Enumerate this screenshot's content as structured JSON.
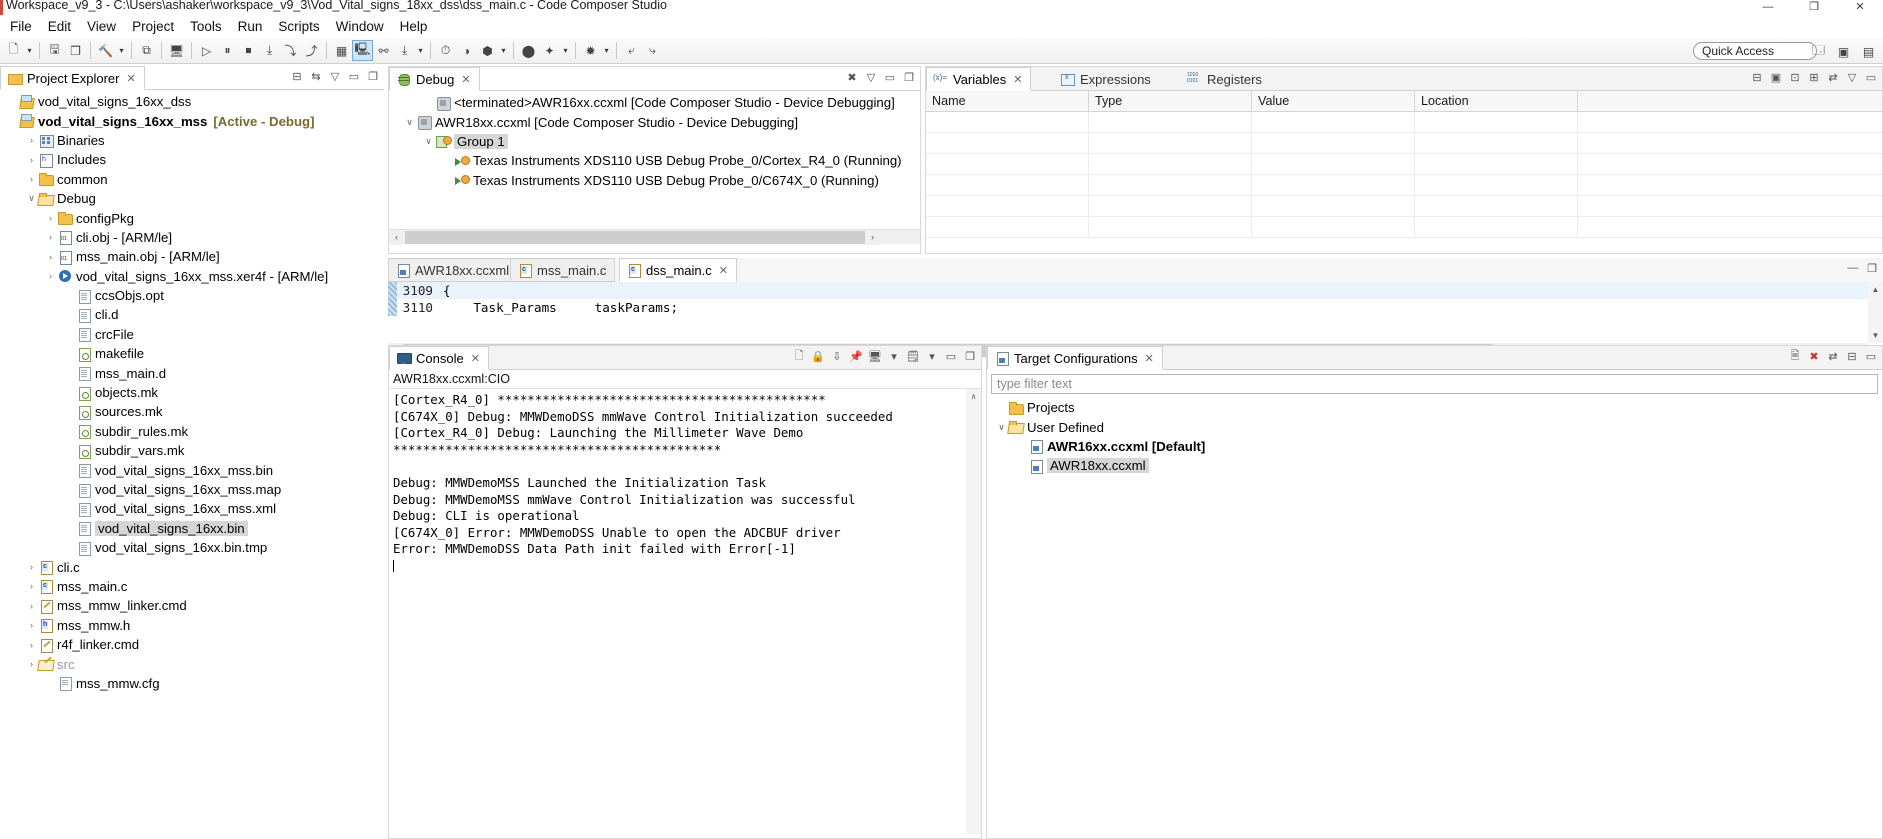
{
  "window": {
    "title": "Workspace_v9_3 - C:\\Users\\ashaker\\workspace_v9_3\\Vod_Vital_signs_18xx_dss\\dss_main.c - Code Composer Studio",
    "minimize": "—",
    "maximize": "❐",
    "close": "✕"
  },
  "menubar": {
    "items": [
      "File",
      "Edit",
      "View",
      "Project",
      "Tools",
      "Run",
      "Scripts",
      "Window",
      "Help"
    ]
  },
  "toolbar": {
    "quick_access_label": "Quick Access",
    "icons": [
      "new-file-icon",
      "save-icon",
      "save-all-icon",
      "build-hammer-icon",
      "debug-skip-icon",
      "terminal-icon",
      "resume-icon",
      "suspend-icon",
      "terminate-icon",
      "step-into-icon",
      "step-over-icon",
      "step-return-icon",
      "grid-icon",
      "restart-icon",
      "connect-target-icon",
      "load-program-icon",
      "clock-icon",
      "disassembly-icon",
      "memory-icon",
      "run-free-icon",
      "profile-icon",
      "debug-perspective-icon",
      "search-icon",
      "link-icon"
    ]
  },
  "project_explorer": {
    "tab_label": "Project Explorer",
    "tools": [
      "collapse-all-icon",
      "link-with-editor-icon"
    ],
    "items": [
      {
        "label": "vod_vital_signs_16xx_dss",
        "icon": "rtsc-project-icon",
        "indent": 0,
        "twist": "",
        "bold": false,
        "suffix": ""
      },
      {
        "label": "vod_vital_signs_16xx_mss",
        "icon": "rtsc-project-icon",
        "indent": 0,
        "twist": "",
        "bold": true,
        "suffix": "[Active - Debug]"
      },
      {
        "label": "Binaries",
        "icon": "binaries-icon",
        "indent": 1,
        "twist": "›",
        "bold": false,
        "suffix": ""
      },
      {
        "label": "Includes",
        "icon": "includes-icon",
        "indent": 1,
        "twist": "›",
        "bold": false,
        "suffix": ""
      },
      {
        "label": "common",
        "icon": "folder-icon",
        "indent": 1,
        "twist": "›",
        "bold": false,
        "suffix": ""
      },
      {
        "label": "Debug",
        "icon": "folder-open-icon",
        "indent": 1,
        "twist": "∨",
        "bold": false,
        "suffix": ""
      },
      {
        "label": "configPkg",
        "icon": "folder-icon",
        "indent": 2,
        "twist": "›",
        "bold": false,
        "suffix": ""
      },
      {
        "label": "cli.obj - [ARM/le]",
        "icon": "object-file-icon",
        "indent": 2,
        "twist": "›",
        "bold": false,
        "suffix": ""
      },
      {
        "label": "mss_main.obj - [ARM/le]",
        "icon": "object-file-icon",
        "indent": 2,
        "twist": "›",
        "bold": false,
        "suffix": ""
      },
      {
        "label": "vod_vital_signs_16xx_mss.xer4f - [ARM/le]",
        "icon": "executable-icon",
        "indent": 2,
        "twist": "›",
        "bold": false,
        "suffix": ""
      },
      {
        "label": "ccsObjs.opt",
        "icon": "file-icon",
        "indent": 3,
        "twist": "",
        "bold": false,
        "suffix": ""
      },
      {
        "label": "cli.d",
        "icon": "file-icon",
        "indent": 3,
        "twist": "",
        "bold": false,
        "suffix": ""
      },
      {
        "label": "crcFile",
        "icon": "file-icon",
        "indent": 3,
        "twist": "",
        "bold": false,
        "suffix": ""
      },
      {
        "label": "makefile",
        "icon": "makefile-icon",
        "indent": 3,
        "twist": "",
        "bold": false,
        "suffix": ""
      },
      {
        "label": "mss_main.d",
        "icon": "file-icon",
        "indent": 3,
        "twist": "",
        "bold": false,
        "suffix": ""
      },
      {
        "label": "objects.mk",
        "icon": "makefile-icon",
        "indent": 3,
        "twist": "",
        "bold": false,
        "suffix": ""
      },
      {
        "label": "sources.mk",
        "icon": "makefile-icon",
        "indent": 3,
        "twist": "",
        "bold": false,
        "suffix": ""
      },
      {
        "label": "subdir_rules.mk",
        "icon": "makefile-icon",
        "indent": 3,
        "twist": "",
        "bold": false,
        "suffix": ""
      },
      {
        "label": "subdir_vars.mk",
        "icon": "makefile-icon",
        "indent": 3,
        "twist": "",
        "bold": false,
        "suffix": ""
      },
      {
        "label": "vod_vital_signs_16xx_mss.bin",
        "icon": "file-icon",
        "indent": 3,
        "twist": "",
        "bold": false,
        "suffix": ""
      },
      {
        "label": "vod_vital_signs_16xx_mss.map",
        "icon": "file-icon",
        "indent": 3,
        "twist": "",
        "bold": false,
        "suffix": ""
      },
      {
        "label": "vod_vital_signs_16xx_mss.xml",
        "icon": "file-icon",
        "indent": 3,
        "twist": "",
        "bold": false,
        "suffix": ""
      },
      {
        "label": "vod_vital_signs_16xx.bin",
        "icon": "file-icon",
        "indent": 3,
        "twist": "",
        "bold": false,
        "suffix": "",
        "selected": true
      },
      {
        "label": "vod_vital_signs_16xx.bin.tmp",
        "icon": "file-icon",
        "indent": 3,
        "twist": "",
        "bold": false,
        "suffix": ""
      },
      {
        "label": "cli.c",
        "icon": "c-file-icon",
        "indent": 1,
        "twist": "›",
        "bold": false,
        "suffix": ""
      },
      {
        "label": "mss_main.c",
        "icon": "c-file-icon",
        "indent": 1,
        "twist": "›",
        "bold": false,
        "suffix": ""
      },
      {
        "label": "mss_mmw_linker.cmd",
        "icon": "cmd-file-icon",
        "indent": 1,
        "twist": "›",
        "bold": false,
        "suffix": ""
      },
      {
        "label": "mss_mmw.h",
        "icon": "h-file-icon",
        "indent": 1,
        "twist": "›",
        "bold": false,
        "suffix": ""
      },
      {
        "label": "r4f_linker.cmd",
        "icon": "cmd-file-icon",
        "indent": 1,
        "twist": "›",
        "bold": false,
        "suffix": ""
      },
      {
        "label": "src",
        "icon": "src-folder-icon",
        "indent": 1,
        "twist": "›",
        "bold": false,
        "suffix": "",
        "grey": true
      },
      {
        "label": "mss_mmw.cfg",
        "icon": "cfg-file-icon",
        "indent": 2,
        "twist": "",
        "bold": false,
        "suffix": ""
      }
    ]
  },
  "debug_view": {
    "tab_label": "Debug",
    "tools": [
      "pin-icon",
      "view-menu-icon",
      "minimize-icon",
      "maximize-icon"
    ],
    "items": [
      {
        "label": "<terminated>AWR16xx.ccxml [Code Composer Studio - Device Debugging]",
        "icon": "debug-node-icon",
        "indent": 1,
        "twist": ""
      },
      {
        "label": "AWR18xx.ccxml [Code Composer Studio - Device Debugging]",
        "icon": "debug-node-icon",
        "indent": 0,
        "twist": "∨"
      },
      {
        "label": "Group 1",
        "icon": "group-icon",
        "indent": 1,
        "twist": "∨",
        "selected": true
      },
      {
        "label": "Texas Instruments XDS110 USB Debug Probe_0/Cortex_R4_0 (Running)",
        "icon": "thread-icon",
        "indent": 2,
        "twist": ""
      },
      {
        "label": "Texas Instruments XDS110 USB Debug Probe_0/C674X_0 (Running)",
        "icon": "thread-icon",
        "indent": 2,
        "twist": ""
      }
    ],
    "scroll_left": "‹",
    "scroll_right": "›"
  },
  "variables_view": {
    "tabs": [
      {
        "label": "Variables",
        "icon": "variables-icon",
        "active": true,
        "closable": true
      },
      {
        "label": "Expressions",
        "icon": "expressions-icon",
        "active": false,
        "closable": false
      },
      {
        "label": "Registers",
        "icon": "registers-icon",
        "active": false,
        "closable": false
      }
    ],
    "columns": [
      "Name",
      "Type",
      "Value",
      "Location"
    ],
    "rows": [],
    "empty_row_count": 6
  },
  "editor": {
    "tabs": [
      {
        "label": "AWR18xx.ccxml",
        "icon": "ccxml-file-icon",
        "active": false,
        "closable": false
      },
      {
        "label": "mss_main.c",
        "icon": "c-file-icon",
        "active": false,
        "closable": false
      },
      {
        "label": "dss_main.c",
        "icon": "c-file-icon",
        "active": true,
        "closable": true
      }
    ],
    "lines": [
      {
        "num": "3109",
        "text": "{",
        "highlight": true
      },
      {
        "num": "3110",
        "text": "    Task_Params     taskParams;",
        "highlight": false
      }
    ],
    "minimize": "—",
    "maximize": "❐"
  },
  "console": {
    "tab_label": "Console",
    "tools": [
      "clear-console-icon",
      "lock-scroll-icon",
      "pin-console-icon",
      "display-console-icon",
      "open-console-icon",
      "minimize-icon",
      "maximize-icon"
    ],
    "stream_label": "AWR18xx.ccxml:CIO",
    "lines": [
      "[Cortex_R4_0] ********************************************",
      "[C674X_0] Debug: MMWDemoDSS mmWave Control Initialization succeeded",
      "[Cortex_R4_0] Debug: Launching the Millimeter Wave Demo",
      "********************************************",
      "",
      "Debug: MMWDemoMSS Launched the Initialization Task",
      "Debug: MMWDemoMSS mmWave Control Initialization was successful",
      "Debug: CLI is operational",
      "[C674X_0] Error: MMWDemoDSS Unable to open the ADCBUF driver",
      "Error: MMWDemoDSS Data Path init failed with Error[-1]"
    ],
    "scroll_up": "∧",
    "scroll_down": "∨"
  },
  "target_configurations": {
    "tab_label": "Target Configurations",
    "tools": [
      "new-target-config-icon",
      "delete-icon",
      "link-icon",
      "view-menu-icon",
      "minimize-icon",
      "maximize-icon"
    ],
    "filter_placeholder": "type filter text",
    "items": [
      {
        "label": "Projects",
        "icon": "folder-icon",
        "indent": 0,
        "twist": "",
        "bold": false
      },
      {
        "label": "User Defined",
        "icon": "folder-open-icon",
        "indent": 0,
        "twist": "∨",
        "bold": false
      },
      {
        "label": "AWR16xx.ccxml [Default]",
        "icon": "ccxml-file-icon",
        "indent": 1,
        "twist": "",
        "bold": true
      },
      {
        "label": "AWR18xx.ccxml",
        "icon": "ccxml-file-icon",
        "indent": 1,
        "twist": "",
        "bold": false,
        "selected": true
      }
    ]
  },
  "colors": {
    "accent": "#2a6fb8",
    "active_project": "#7a6a2e",
    "selection": "#d6d6d6",
    "error": "#000000",
    "tab_active_bg": "#ffffff"
  }
}
